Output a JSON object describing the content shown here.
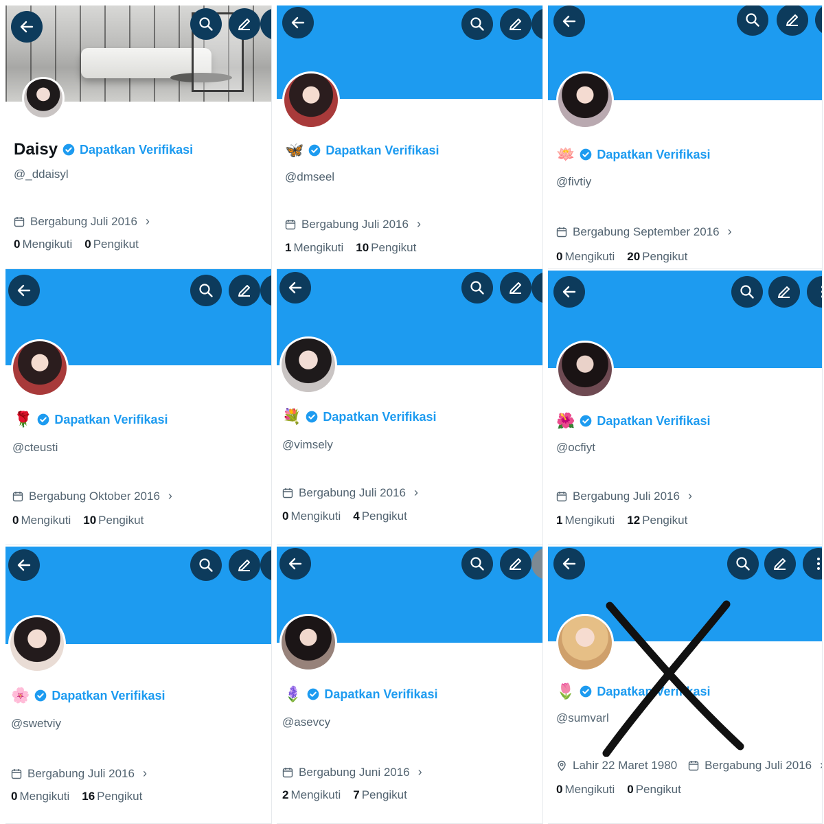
{
  "panels": [
    {
      "display_name": "Daisy",
      "emoji": "",
      "verify_label": "Dapatkan Verifikasi",
      "handle": "@_ddaisyl",
      "location": "",
      "joined": "Bergabung Juli 2016",
      "following_count": "0",
      "following_label": "Mengikuti",
      "followers_count": "0",
      "followers_label": "Pengikut"
    },
    {
      "display_name": "",
      "emoji": "🦋",
      "verify_label": "Dapatkan Verifikasi",
      "handle": "@dmseel",
      "location": "",
      "joined": "Bergabung Juli 2016",
      "following_count": "1",
      "following_label": "Mengikuti",
      "followers_count": "10",
      "followers_label": "Pengikut"
    },
    {
      "display_name": "",
      "emoji": "🪷",
      "verify_label": "Dapatkan Verifikasi",
      "handle": "@fivtiy",
      "location": "",
      "joined": "Bergabung September 2016",
      "following_count": "0",
      "following_label": "Mengikuti",
      "followers_count": "20",
      "followers_label": "Pengikut"
    },
    {
      "display_name": "",
      "emoji": "🌹",
      "verify_label": "Dapatkan Verifikasi",
      "handle": "@cteusti",
      "location": "",
      "joined": "Bergabung Oktober 2016",
      "following_count": "0",
      "following_label": "Mengikuti",
      "followers_count": "10",
      "followers_label": "Pengikut"
    },
    {
      "display_name": "",
      "emoji": "💐",
      "verify_label": "Dapatkan Verifikasi",
      "handle": "@vimsely",
      "location": "",
      "joined": "Bergabung Juli 2016",
      "following_count": "0",
      "following_label": "Mengikuti",
      "followers_count": "4",
      "followers_label": "Pengikut"
    },
    {
      "display_name": "",
      "emoji": "🌺",
      "verify_label": "Dapatkan Verifikasi",
      "handle": "@ocfiyt",
      "location": "",
      "joined": "Bergabung Juli 2016",
      "following_count": "1",
      "following_label": "Mengikuti",
      "followers_count": "12",
      "followers_label": "Pengikut"
    },
    {
      "display_name": "",
      "emoji": "🌸",
      "verify_label": "Dapatkan Verifikasi",
      "handle": "@swetviy",
      "location": "",
      "joined": "Bergabung Juli 2016",
      "following_count": "0",
      "following_label": "Mengikuti",
      "followers_count": "16",
      "followers_label": "Pengikut"
    },
    {
      "display_name": "",
      "emoji": "🪻",
      "verify_label": "Dapatkan Verifikasi",
      "handle": "@asevcy",
      "location": "",
      "joined": "Bergabung Juni 2016",
      "following_count": "2",
      "following_label": "Mengikuti",
      "followers_count": "7",
      "followers_label": "Pengikut"
    },
    {
      "display_name": "",
      "emoji": "🌷",
      "verify_label": "Dapatkan Verifikasi",
      "handle": "@sumvarl",
      "location": "Lahir 22 Maret 1980",
      "joined": "Bergabung Juli 2016",
      "following_count": "0",
      "following_label": "Mengikuti",
      "followers_count": "0",
      "followers_label": "Pengikut"
    }
  ],
  "colors": {
    "banner": "#1d9bf0",
    "button": "#0d3b5c",
    "verified": "#1d9bf0",
    "muted": "#536471"
  },
  "icons": [
    "back-arrow-icon",
    "search-icon",
    "edit-icon",
    "more-icon",
    "verified-badge-icon",
    "calendar-icon",
    "location-pin-icon",
    "chevron-right-icon"
  ]
}
